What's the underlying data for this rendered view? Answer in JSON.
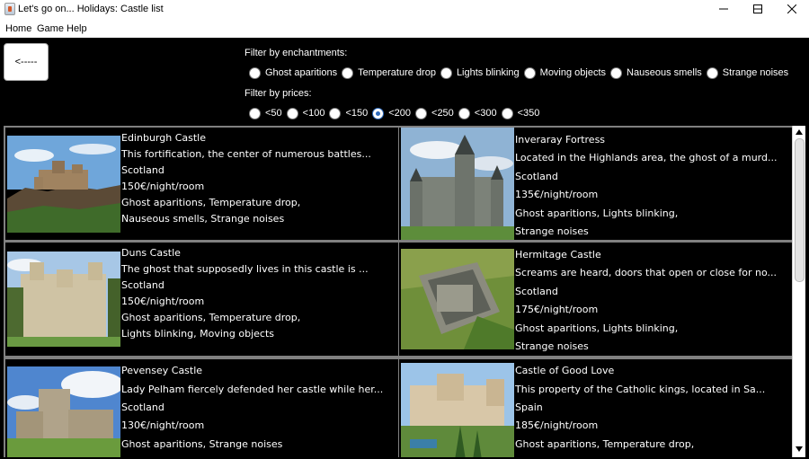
{
  "window": {
    "title": "Let's go on... Holidays: Castle list",
    "icon": "java-app-icon"
  },
  "menu": {
    "items": [
      "Home",
      "Game",
      "Help"
    ]
  },
  "back_button": {
    "label": "<-----"
  },
  "filters": {
    "enchantments_label": "Filter by enchantments:",
    "enchantments": [
      {
        "label": "Ghost aparitions",
        "checked": false
      },
      {
        "label": "Temperature drop",
        "checked": false
      },
      {
        "label": "Lights blinking",
        "checked": false
      },
      {
        "label": "Moving objects",
        "checked": false
      },
      {
        "label": "Nauseous smells",
        "checked": false
      },
      {
        "label": "Strange noises",
        "checked": false
      }
    ],
    "prices_label": "Filter by prices:",
    "prices": [
      {
        "label": "<50",
        "checked": false
      },
      {
        "label": "<100",
        "checked": false
      },
      {
        "label": "<150",
        "checked": false
      },
      {
        "label": "<200",
        "checked": true
      },
      {
        "label": "<250",
        "checked": false
      },
      {
        "label": "<300",
        "checked": false
      },
      {
        "label": "<350",
        "checked": false
      }
    ]
  },
  "castles": [
    {
      "name": "Edinburgh Castle",
      "description": "This fortification, the center of numerous battles...",
      "country": "Scotland",
      "price": "150€/night/room",
      "features_1": "Ghost aparitions, Temperature drop,",
      "features_2": "Nauseous smells, Strange noises"
    },
    {
      "name": "Inveraray Fortress",
      "description": "Located in the Highlands area, the ghost of a murd...",
      "country": "Scotland",
      "price": "135€/night/room",
      "features_1": "Ghost aparitions, Lights blinking,",
      "features_2": "Strange noises"
    },
    {
      "name": "Duns Castle",
      "description": "The ghost that supposedly lives in this castle is ...",
      "country": "Scotland",
      "price": "150€/night/room",
      "features_1": "Ghost aparitions, Temperature drop,",
      "features_2": "Lights blinking, Moving objects"
    },
    {
      "name": "Hermitage Castle",
      "description": "Screams are heard, doors that open or close for no...",
      "country": "Scotland",
      "price": "175€/night/room",
      "features_1": "Ghost aparitions, Lights blinking,",
      "features_2": "Strange noises"
    },
    {
      "name": "Pevensey Castle",
      "description": "Lady Pelham fiercely defended her castle while her...",
      "country": "Scotland",
      "price": "130€/night/room",
      "features_1": "Ghost aparitions, Strange noises",
      "features_2": ""
    },
    {
      "name": "Castle of Good Love",
      "description": "This property of the Catholic kings, located in Sa...",
      "country": "Spain",
      "price": "185€/night/room",
      "features_1": "Ghost aparitions, Temperature drop,",
      "features_2": ""
    }
  ]
}
